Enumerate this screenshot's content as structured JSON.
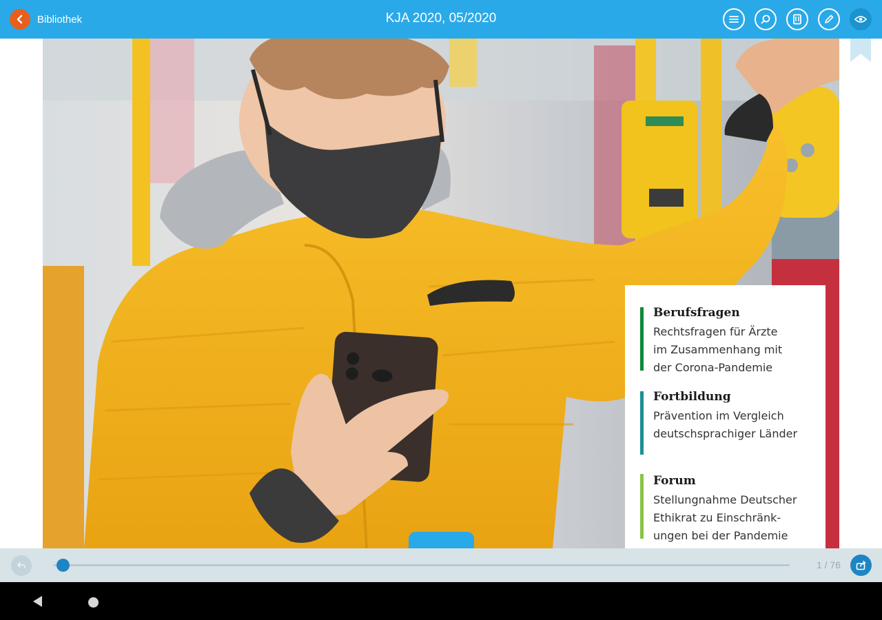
{
  "topbar": {
    "back_label": "Bibliothek",
    "title": "KJA 2020, 05/2020",
    "icons": [
      "menu-icon",
      "search-icon",
      "pages-icon",
      "pen-icon",
      "eye-icon"
    ]
  },
  "toc": [
    {
      "heading": "Berufsfragen",
      "text": "Rechtsfragen für Ärzte\nim Zusammenhang mit\nder Corona-Pandemie",
      "color": "#0c8a3c"
    },
    {
      "heading": "Fortbildung",
      "text": "Prävention im Vergleich\ndeutschsprachiger Länder",
      "color": "#1e8f98"
    },
    {
      "heading": "Forum",
      "text": "Stellungnahme Deutscher\nEthikrat zu Einschränk-\nungen bei der Pandemie",
      "color": "#8bc34a"
    }
  ],
  "scrubber": {
    "page_count": "1 / 76",
    "progress": 0.013
  },
  "colors": {
    "topbar": "#2aa9e8",
    "back_button": "#e85f1c",
    "jacket": "#f4b21c",
    "accent_dark": "#1e85c4"
  }
}
